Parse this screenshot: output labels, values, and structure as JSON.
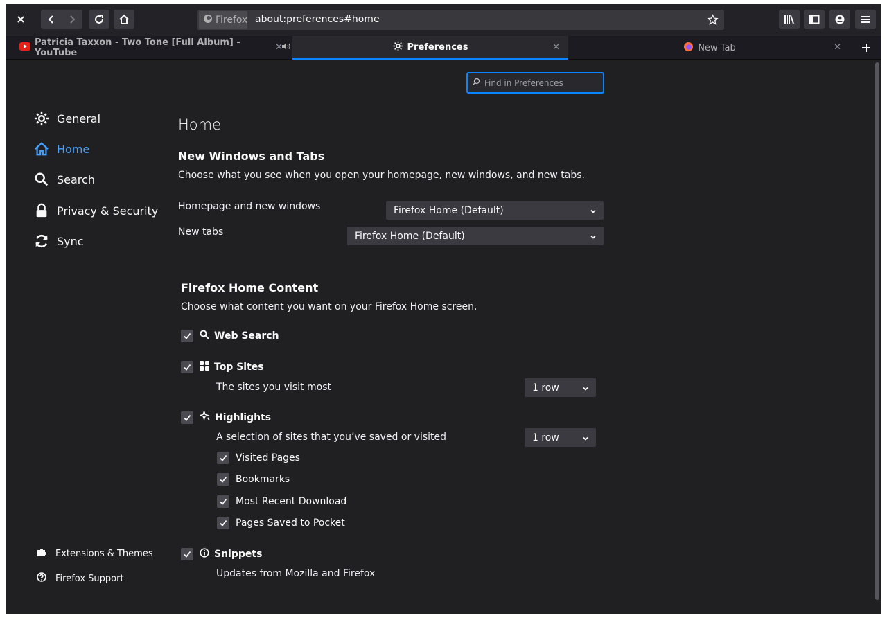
{
  "toolbar": {
    "identity_label": "Firefox",
    "url": "about:preferences#home"
  },
  "tabs": [
    {
      "title": "Patricia Taxxon - Two Tone [Full Album] - YouTube",
      "selected": false
    },
    {
      "title": "Preferences",
      "selected": true
    },
    {
      "title": "New Tab",
      "selected": false
    }
  ],
  "search": {
    "placeholder": "Find in Preferences"
  },
  "sidebar": {
    "items": [
      {
        "label": "General",
        "icon": "gear-icon"
      },
      {
        "label": "Home",
        "icon": "home-icon",
        "active": true
      },
      {
        "label": "Search",
        "icon": "search-icon"
      },
      {
        "label": "Privacy & Security",
        "icon": "lock-icon"
      },
      {
        "label": "Sync",
        "icon": "sync-icon"
      }
    ],
    "footer": [
      {
        "label": "Extensions & Themes",
        "icon": "puzzle-icon"
      },
      {
        "label": "Firefox Support",
        "icon": "help-icon"
      }
    ]
  },
  "main": {
    "title": "Home",
    "new_windows": {
      "heading": "New Windows and Tabs",
      "description": "Choose what you see when you open your homepage, new windows, and new tabs.",
      "homepage_label": "Homepage and new windows",
      "homepage_value": "Firefox Home (Default)",
      "newtabs_label": "New tabs",
      "newtabs_value": "Firefox Home (Default)"
    },
    "home_content": {
      "heading": "Firefox Home Content",
      "description": "Choose what content you want on your Firefox Home screen.",
      "web_search": "Web Search",
      "top_sites": "Top Sites",
      "top_sites_desc": "The sites you visit most",
      "top_sites_rows": "1 row",
      "highlights": "Highlights",
      "highlights_desc": "A selection of sites that you’ve saved or visited",
      "highlights_rows": "1 row",
      "sub": [
        "Visited Pages",
        "Bookmarks",
        "Most Recent Download",
        "Pages Saved to Pocket"
      ],
      "snippets": "Snippets",
      "snippets_desc": "Updates from Mozilla and Firefox"
    }
  },
  "colors": {
    "accent": "#0a84ff",
    "active_nav": "#45a1ff",
    "background": "#202023"
  }
}
